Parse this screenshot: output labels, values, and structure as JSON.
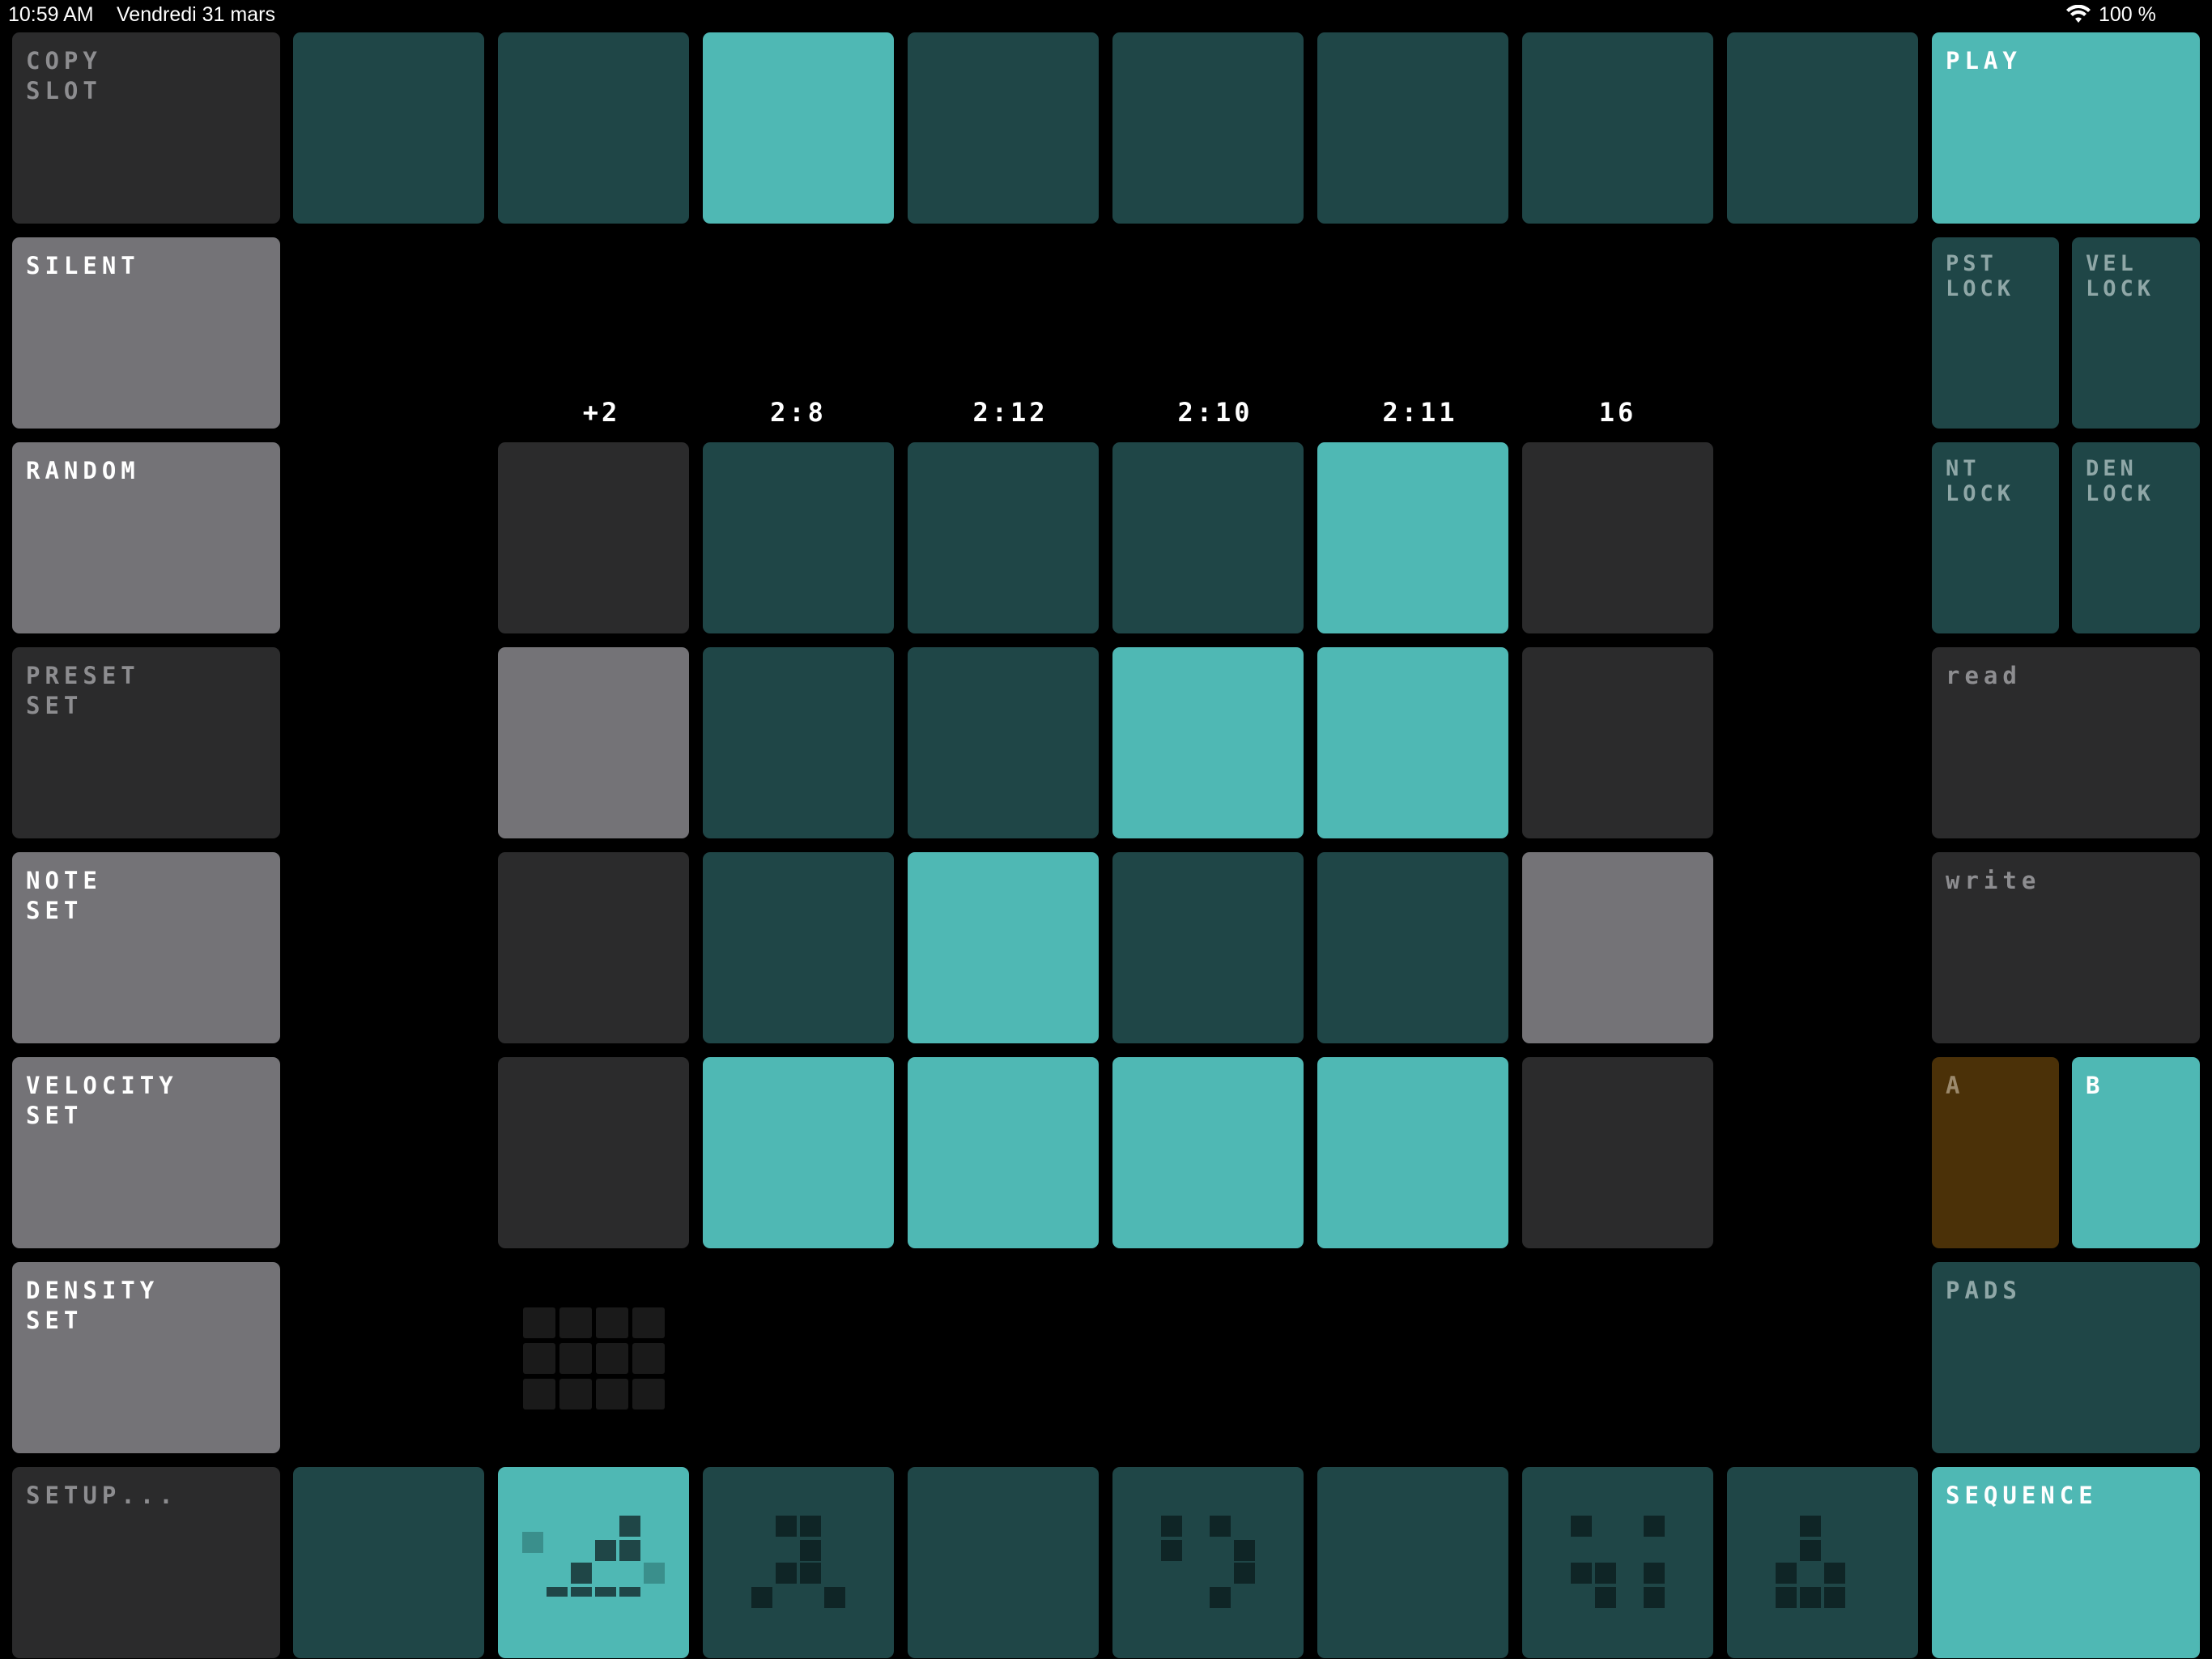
{
  "status_bar": {
    "time": "10:59 AM",
    "date": "Vendredi 31 mars",
    "battery": "100 %",
    "wifi_icon": "wifi-icon"
  },
  "colors": {
    "dark_teal": "#1f4647",
    "teal": "#4fb8b4",
    "black_pad": "#2b2b2c",
    "gray_pad": "#747377",
    "amber": "#4b3108"
  },
  "left": {
    "copy_slot": "COPY\nSLOT",
    "silent": "SILENT",
    "random": "RANDOM",
    "preset_set": "PRESET\nSET",
    "note_set": "NOTE\nSET",
    "velocity_set": "VELOCITY\nSET",
    "density_set": "DENSITY\nSET",
    "setup": "SETUP..."
  },
  "right": {
    "play": "PLAY",
    "pst_lock": "PST\nLOCK",
    "vel_lock": "VEL\nLOCK",
    "nt_lock": "NT\nLOCK",
    "den_lock": "DEN\nLOCK",
    "read": "read",
    "write": "write",
    "bank_a": "A",
    "bank_b": "B",
    "pads": "PADS",
    "sequence": "SEQUENCE"
  },
  "column_headers": [
    "+2",
    "2:8",
    "2:12",
    "2:10",
    "2:11",
    "16"
  ],
  "top_row_slots": [
    "dark",
    "dark",
    "teal",
    "dark",
    "dark",
    "dark",
    "dark",
    "dark"
  ],
  "grid": [
    [
      "black",
      "dark",
      "dark",
      "dark",
      "teal",
      "black"
    ],
    [
      "gray",
      "dark",
      "dark",
      "teal",
      "teal",
      "black"
    ],
    [
      "black",
      "dark",
      "teal",
      "dark",
      "dark",
      "gray"
    ],
    [
      "black",
      "teal",
      "teal",
      "teal",
      "teal",
      "black"
    ]
  ],
  "bottom_row_patterns": [
    "dark",
    "teal",
    "dark",
    "dark",
    "dark",
    "dark",
    "dark",
    "dark"
  ]
}
